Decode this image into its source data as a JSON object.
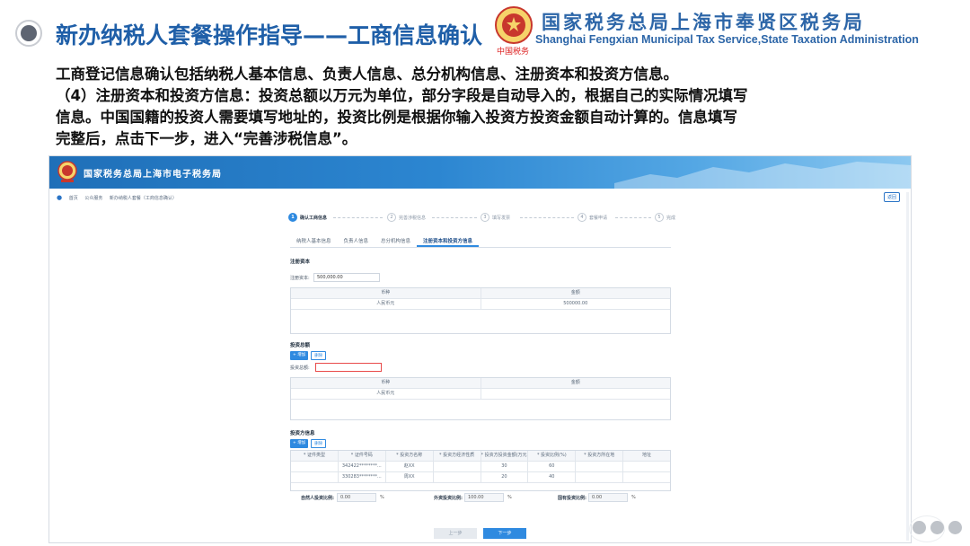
{
  "slide": {
    "title": "新办纳税人套餐操作指导——工商信息确认",
    "org_cn": "国家税务总局上海市奉贤区税务局",
    "org_en": "Shanghai Fengxian Municipal Tax Service,State Taxation Administration",
    "emblem_sign": "中国税务",
    "description": [
      "工商登记信息确认包括纳税人基本信息、负责人信息、总分机构信息、注册资本和投资方信息。",
      "（4）注册资本和投资方信息：投资总额以万元为单位，部分字段是自动导入的，根据自己的实际情况填写",
      "信息。中国国籍的投资人需要填写地址的，投资比例是根据你输入投资方投资金额自动计算的。信息填写",
      "完整后，点击下一步，进入“完善涉税信息”。"
    ]
  },
  "portal": {
    "title": "国家税务总局上海市电子税务局",
    "breadcrumb": [
      "首页",
      "公众服务",
      "新办纳税人套餐（工商信息确认）"
    ],
    "back_label": "返回",
    "steps": [
      {
        "num": "1",
        "label": "确认工商信息",
        "active": true
      },
      {
        "num": "2",
        "label": "完善涉税信息",
        "active": false
      },
      {
        "num": "3",
        "label": "填写发票",
        "active": false
      },
      {
        "num": "4",
        "label": "套餐申请",
        "active": false
      },
      {
        "num": "5",
        "label": "完成",
        "active": false
      }
    ],
    "tabs": [
      "纳税人基本信息",
      "负责人信息",
      "总分机构信息",
      "注册资本和投资方信息"
    ],
    "active_tab": 3,
    "capital": {
      "section_title": "注册资本",
      "label": "注册资本:",
      "value": "500,000.00",
      "table_headers": [
        "币种",
        "金额"
      ],
      "rows": [
        [
          "人民币元",
          "500000.00"
        ]
      ]
    },
    "investment_total": {
      "section_title": "投资总额",
      "add_label": "+ 增加",
      "delete_label": "删除",
      "label": "投资总额:",
      "value": "",
      "table_headers": [
        "币种",
        "金额"
      ],
      "rows": [
        [
          "人民币元",
          ""
        ]
      ]
    },
    "investors": {
      "section_title": "投资方信息",
      "add_label": "+ 增加",
      "delete_label": "删除",
      "headers": [
        "* 证件类型",
        "* 证件号码",
        "* 投资方名称",
        "* 投资方经济性质",
        "* 投资方投资金额(万元)",
        "* 投资比例(%)",
        "* 投资方所在地",
        "地址"
      ],
      "rows": [
        [
          "",
          "342422********...",
          "赵XX",
          "",
          "30",
          "60",
          "",
          ""
        ],
        [
          "",
          "330283********...",
          "周XX",
          "",
          "20",
          "40",
          "",
          ""
        ]
      ]
    },
    "ratios": [
      {
        "label": "自然人投资比例:",
        "value": "0.00",
        "unit": "%"
      },
      {
        "label": "外资投资比例:",
        "value": "100.00",
        "unit": "%"
      },
      {
        "label": "国有投资比例:",
        "value": "0.00",
        "unit": "%"
      }
    ],
    "prev_label": "上一步",
    "next_label": "下一步"
  },
  "colors": {
    "title_blue": "#1f5fa8",
    "accent": "#2f8ae0",
    "error": "#e84a4a"
  }
}
